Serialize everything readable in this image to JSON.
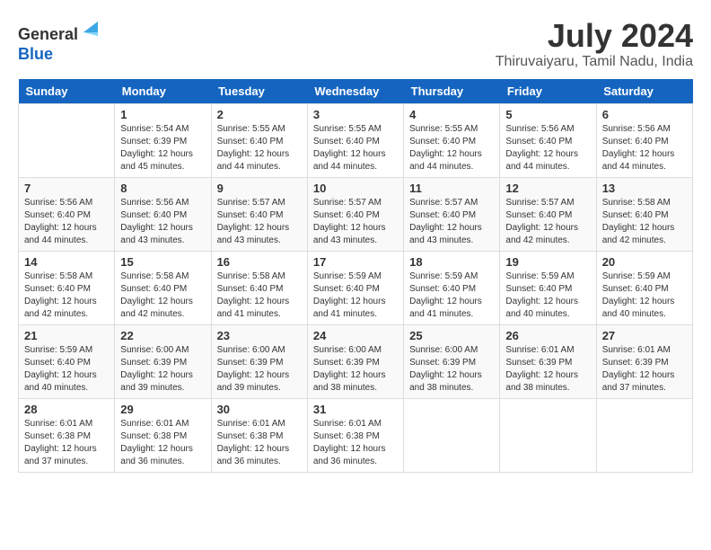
{
  "header": {
    "logo_line1": "General",
    "logo_line2": "Blue",
    "title": "July 2024",
    "subtitle": "Thiruvaiyaru, Tamil Nadu, India"
  },
  "columns": [
    "Sunday",
    "Monday",
    "Tuesday",
    "Wednesday",
    "Thursday",
    "Friday",
    "Saturday"
  ],
  "weeks": [
    [
      {
        "day": "",
        "info": ""
      },
      {
        "day": "1",
        "info": "Sunrise: 5:54 AM\nSunset: 6:39 PM\nDaylight: 12 hours\nand 45 minutes."
      },
      {
        "day": "2",
        "info": "Sunrise: 5:55 AM\nSunset: 6:40 PM\nDaylight: 12 hours\nand 44 minutes."
      },
      {
        "day": "3",
        "info": "Sunrise: 5:55 AM\nSunset: 6:40 PM\nDaylight: 12 hours\nand 44 minutes."
      },
      {
        "day": "4",
        "info": "Sunrise: 5:55 AM\nSunset: 6:40 PM\nDaylight: 12 hours\nand 44 minutes."
      },
      {
        "day": "5",
        "info": "Sunrise: 5:56 AM\nSunset: 6:40 PM\nDaylight: 12 hours\nand 44 minutes."
      },
      {
        "day": "6",
        "info": "Sunrise: 5:56 AM\nSunset: 6:40 PM\nDaylight: 12 hours\nand 44 minutes."
      }
    ],
    [
      {
        "day": "7",
        "info": "Sunrise: 5:56 AM\nSunset: 6:40 PM\nDaylight: 12 hours\nand 44 minutes."
      },
      {
        "day": "8",
        "info": "Sunrise: 5:56 AM\nSunset: 6:40 PM\nDaylight: 12 hours\nand 43 minutes."
      },
      {
        "day": "9",
        "info": "Sunrise: 5:57 AM\nSunset: 6:40 PM\nDaylight: 12 hours\nand 43 minutes."
      },
      {
        "day": "10",
        "info": "Sunrise: 5:57 AM\nSunset: 6:40 PM\nDaylight: 12 hours\nand 43 minutes."
      },
      {
        "day": "11",
        "info": "Sunrise: 5:57 AM\nSunset: 6:40 PM\nDaylight: 12 hours\nand 43 minutes."
      },
      {
        "day": "12",
        "info": "Sunrise: 5:57 AM\nSunset: 6:40 PM\nDaylight: 12 hours\nand 42 minutes."
      },
      {
        "day": "13",
        "info": "Sunrise: 5:58 AM\nSunset: 6:40 PM\nDaylight: 12 hours\nand 42 minutes."
      }
    ],
    [
      {
        "day": "14",
        "info": "Sunrise: 5:58 AM\nSunset: 6:40 PM\nDaylight: 12 hours\nand 42 minutes."
      },
      {
        "day": "15",
        "info": "Sunrise: 5:58 AM\nSunset: 6:40 PM\nDaylight: 12 hours\nand 42 minutes."
      },
      {
        "day": "16",
        "info": "Sunrise: 5:58 AM\nSunset: 6:40 PM\nDaylight: 12 hours\nand 41 minutes."
      },
      {
        "day": "17",
        "info": "Sunrise: 5:59 AM\nSunset: 6:40 PM\nDaylight: 12 hours\nand 41 minutes."
      },
      {
        "day": "18",
        "info": "Sunrise: 5:59 AM\nSunset: 6:40 PM\nDaylight: 12 hours\nand 41 minutes."
      },
      {
        "day": "19",
        "info": "Sunrise: 5:59 AM\nSunset: 6:40 PM\nDaylight: 12 hours\nand 40 minutes."
      },
      {
        "day": "20",
        "info": "Sunrise: 5:59 AM\nSunset: 6:40 PM\nDaylight: 12 hours\nand 40 minutes."
      }
    ],
    [
      {
        "day": "21",
        "info": "Sunrise: 5:59 AM\nSunset: 6:40 PM\nDaylight: 12 hours\nand 40 minutes."
      },
      {
        "day": "22",
        "info": "Sunrise: 6:00 AM\nSunset: 6:39 PM\nDaylight: 12 hours\nand 39 minutes."
      },
      {
        "day": "23",
        "info": "Sunrise: 6:00 AM\nSunset: 6:39 PM\nDaylight: 12 hours\nand 39 minutes."
      },
      {
        "day": "24",
        "info": "Sunrise: 6:00 AM\nSunset: 6:39 PM\nDaylight: 12 hours\nand 38 minutes."
      },
      {
        "day": "25",
        "info": "Sunrise: 6:00 AM\nSunset: 6:39 PM\nDaylight: 12 hours\nand 38 minutes."
      },
      {
        "day": "26",
        "info": "Sunrise: 6:01 AM\nSunset: 6:39 PM\nDaylight: 12 hours\nand 38 minutes."
      },
      {
        "day": "27",
        "info": "Sunrise: 6:01 AM\nSunset: 6:39 PM\nDaylight: 12 hours\nand 37 minutes."
      }
    ],
    [
      {
        "day": "28",
        "info": "Sunrise: 6:01 AM\nSunset: 6:38 PM\nDaylight: 12 hours\nand 37 minutes."
      },
      {
        "day": "29",
        "info": "Sunrise: 6:01 AM\nSunset: 6:38 PM\nDaylight: 12 hours\nand 36 minutes."
      },
      {
        "day": "30",
        "info": "Sunrise: 6:01 AM\nSunset: 6:38 PM\nDaylight: 12 hours\nand 36 minutes."
      },
      {
        "day": "31",
        "info": "Sunrise: 6:01 AM\nSunset: 6:38 PM\nDaylight: 12 hours\nand 36 minutes."
      },
      {
        "day": "",
        "info": ""
      },
      {
        "day": "",
        "info": ""
      },
      {
        "day": "",
        "info": ""
      }
    ]
  ]
}
